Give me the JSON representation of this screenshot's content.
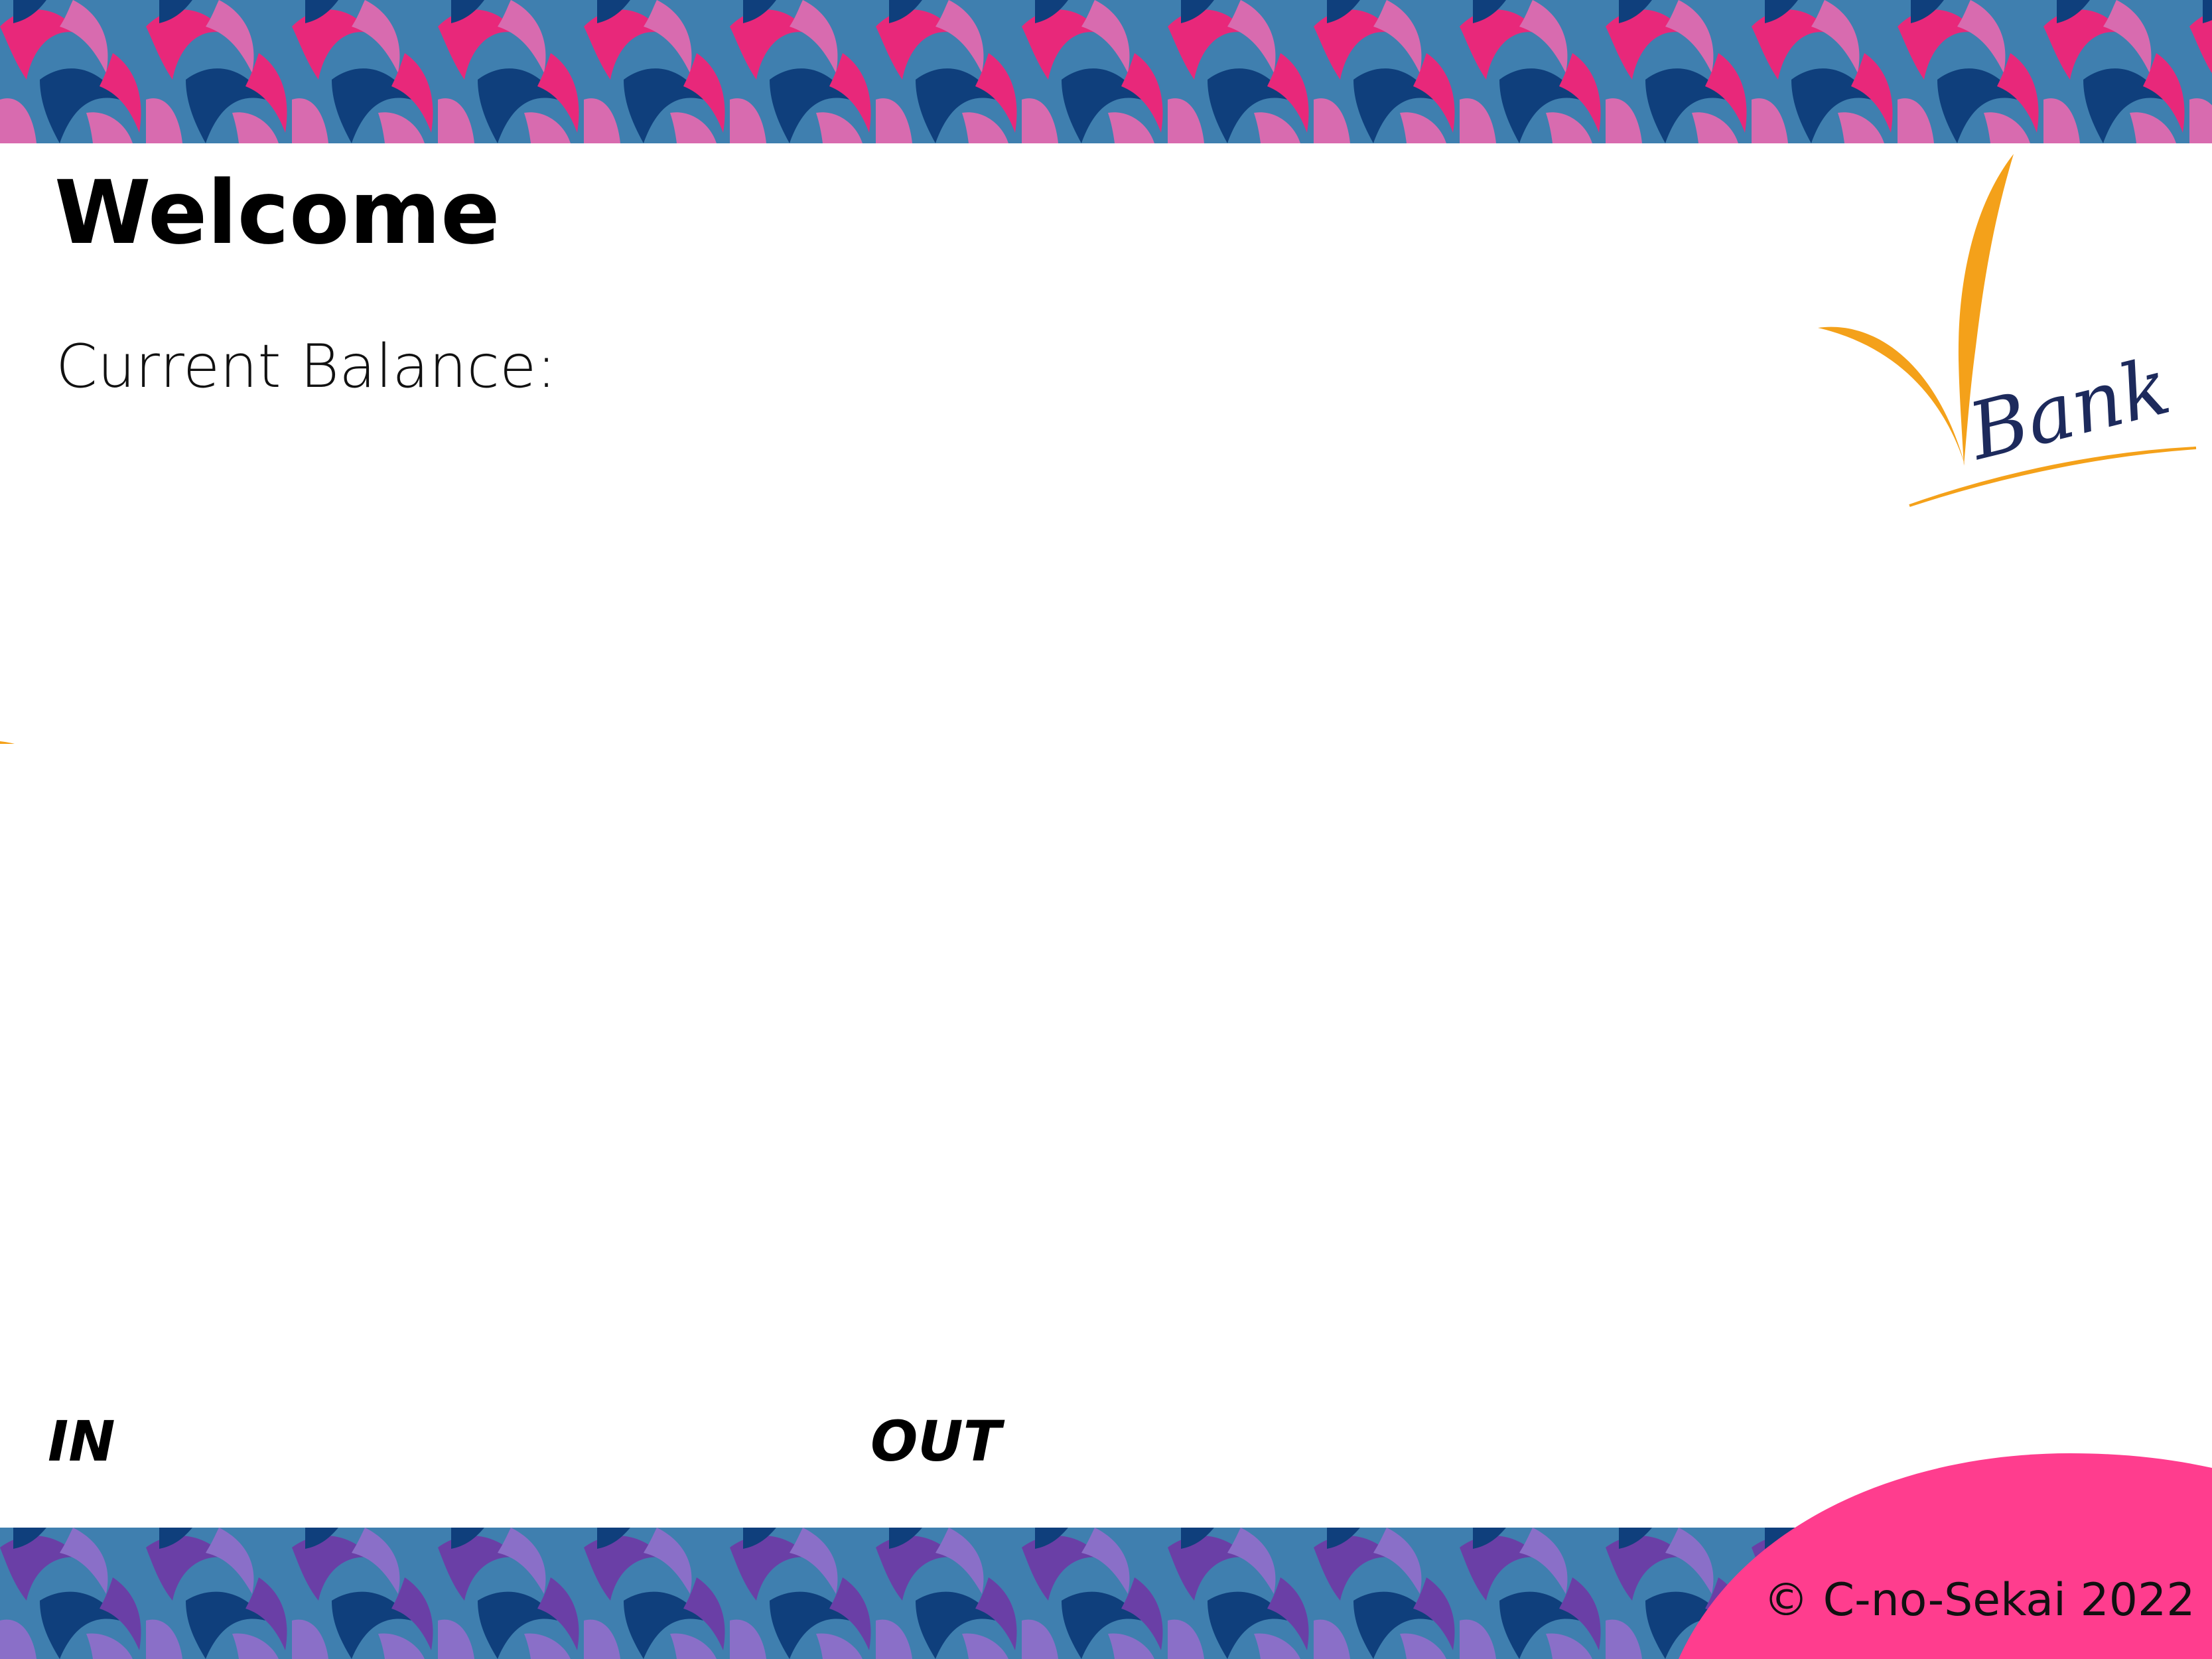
{
  "header": {
    "title": "Welcome",
    "balance_label": "Current Balance:"
  },
  "columns": {
    "in_label": "IN",
    "out_label": "OUT"
  },
  "logo": {
    "text": "Bank",
    "icon": "vbank-logo-icon",
    "colors": {
      "swoosh": "#F4A11A",
      "text": "#1D2A5C"
    }
  },
  "footer": {
    "copyright": "© C-no-Sekai 2022"
  },
  "colors": {
    "top_band_pink": "#E8287A",
    "top_band_blue": "#3F7FAF",
    "top_band_navy": "#0F3F7C",
    "top_band_rose": "#D86BAF",
    "bottom_band_purple": "#6A3FA6",
    "bottom_band_lavender": "#8A6FC8",
    "bottom_band_navy": "#0F3F7C",
    "bottom_band_blue": "#3F7FAF",
    "corner_pink": "#FF3D8E"
  }
}
